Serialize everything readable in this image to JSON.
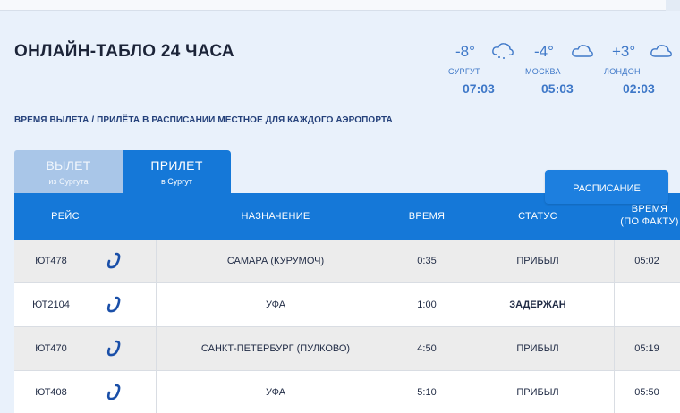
{
  "title": "ОНЛАЙН-ТАБЛО 24 ЧАСА",
  "notice": "ВРЕМЯ ВЫЛЕТА / ПРИЛЁТА В РАСПИСАНИИ МЕСТНОЕ ДЛЯ КАЖДОГО АЭРОПОРТА",
  "weather": [
    {
      "temp": "-8°",
      "city": "СУРГУТ",
      "time": "07:03",
      "icon": "snow-cloud-icon"
    },
    {
      "temp": "-4°",
      "city": "МОСКВА",
      "time": "05:03",
      "icon": "cloud-icon"
    },
    {
      "temp": "+3°",
      "city": "ЛОНДОН",
      "time": "02:03",
      "icon": "cloud-icon"
    }
  ],
  "tabs": {
    "departure": {
      "label": "ВЫЛЕТ",
      "sub": "из Сургута"
    },
    "arrival": {
      "label": "ПРИЛЕТ",
      "sub": "в Сургут"
    }
  },
  "schedule_button": "РАСПИСАНИЕ",
  "table": {
    "columns": {
      "flight": "РЕЙС",
      "destination": "НАЗНАЧЕНИЕ",
      "time": "ВРЕМЯ",
      "status": "СТАТУС",
      "actual_line1": "ВРЕМЯ",
      "actual_line2": "(ПО ФАКТУ)"
    },
    "rows": [
      {
        "flight": "ЮТ478",
        "destination": "САМАРА (КУРУМОЧ)",
        "time": "0:35",
        "status": "ПРИБЫЛ",
        "actual": "05:02"
      },
      {
        "flight": "ЮТ2104",
        "destination": "УФА",
        "time": "1:00",
        "status": "ЗАДЕРЖАН",
        "actual": ""
      },
      {
        "flight": "ЮТ470",
        "destination": "САНКТ-ПЕТЕРБУРГ (ПУЛКОВО)",
        "time": "4:50",
        "status": "ПРИБЫЛ",
        "actual": "05:19"
      },
      {
        "flight": "ЮТ408",
        "destination": "УФА",
        "time": "5:10",
        "status": "ПРИБЫЛ",
        "actual": "05:50"
      }
    ]
  },
  "colors": {
    "accent": "#1578d8",
    "inactive_tab": "#a9c6e8",
    "weather_text": "#3e78c8",
    "background": "#e9f1fb"
  }
}
